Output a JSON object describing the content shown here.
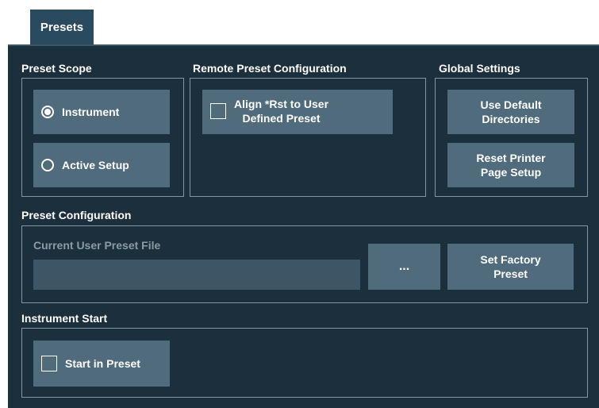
{
  "tab": {
    "label": "Presets"
  },
  "preset_scope": {
    "title": "Preset Scope",
    "options": [
      {
        "label": "Instrument",
        "selected": true
      },
      {
        "label": "Active Setup",
        "selected": false
      }
    ]
  },
  "remote_preset": {
    "title": "Remote Preset Configuration",
    "align_rst": {
      "line1": "Align *Rst to User",
      "line2": "Defined Preset",
      "checked": false
    }
  },
  "global_settings": {
    "title": "Global Settings",
    "use_default_dirs": {
      "line1": "Use Default",
      "line2": "Directories"
    },
    "reset_printer": {
      "line1": "Reset Printer",
      "line2": "Page Setup"
    }
  },
  "preset_config": {
    "title": "Preset Configuration",
    "file_label": "Current User Preset File",
    "file_value": "",
    "browse_label": "...",
    "set_factory": {
      "line1": "Set Factory",
      "line2": "Preset"
    }
  },
  "instrument_start": {
    "title": "Instrument Start",
    "start_in_preset": {
      "label": "Start in Preset",
      "checked": false
    }
  },
  "colors": {
    "panel": "#1c2f3d",
    "button": "#4f6b7c",
    "tab": "#2a4a5f",
    "border": "#7e98a8"
  }
}
